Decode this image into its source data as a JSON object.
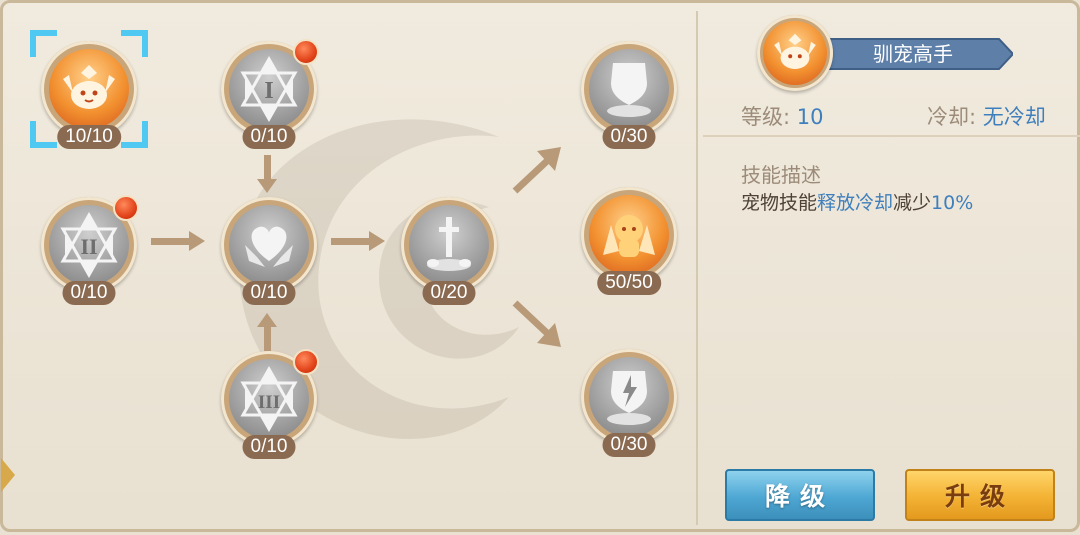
{
  "tree": {
    "nodes": [
      {
        "id": "pet-master",
        "count": "10/10",
        "icon": "pet-face-icon",
        "active": true,
        "selected": true,
        "has_dot": false
      },
      {
        "id": "rune-i",
        "count": "0/10",
        "icon": "rune-i-icon",
        "active": false,
        "has_dot": true
      },
      {
        "id": "rune-ii",
        "count": "0/10",
        "icon": "rune-ii-icon",
        "active": false,
        "has_dot": true
      },
      {
        "id": "heart",
        "count": "0/10",
        "icon": "heart-wings-icon",
        "active": false,
        "has_dot": false
      },
      {
        "id": "rune-iii",
        "count": "0/10",
        "icon": "rune-iii-icon",
        "active": false,
        "has_dot": true
      },
      {
        "id": "sword",
        "count": "0/20",
        "icon": "sword-icon",
        "active": false,
        "has_dot": false
      },
      {
        "id": "shield",
        "count": "0/30",
        "icon": "shield-icon",
        "active": false,
        "has_dot": false
      },
      {
        "id": "spirit",
        "count": "50/50",
        "icon": "spirit-icon",
        "active": true,
        "has_dot": false
      },
      {
        "id": "shield-bolt",
        "count": "0/30",
        "icon": "shield-bolt-icon",
        "active": false,
        "has_dot": false
      }
    ]
  },
  "detail": {
    "skill_name": "驯宠高手",
    "level_label": "等级:",
    "level_value": "10",
    "cooldown_label": "冷却:",
    "cooldown_value": "无冷却",
    "desc_title": "技能描述",
    "desc_pre": "宠物技能",
    "desc_hl1": "释放冷却",
    "desc_mid": "减少",
    "desc_hl2": "10%"
  },
  "buttons": {
    "downgrade": "降级",
    "upgrade": "升级"
  },
  "colors": {
    "accent_blue": "#3f7fbd",
    "orange": "#f2902f",
    "badge_bg": "#8a6a50"
  }
}
